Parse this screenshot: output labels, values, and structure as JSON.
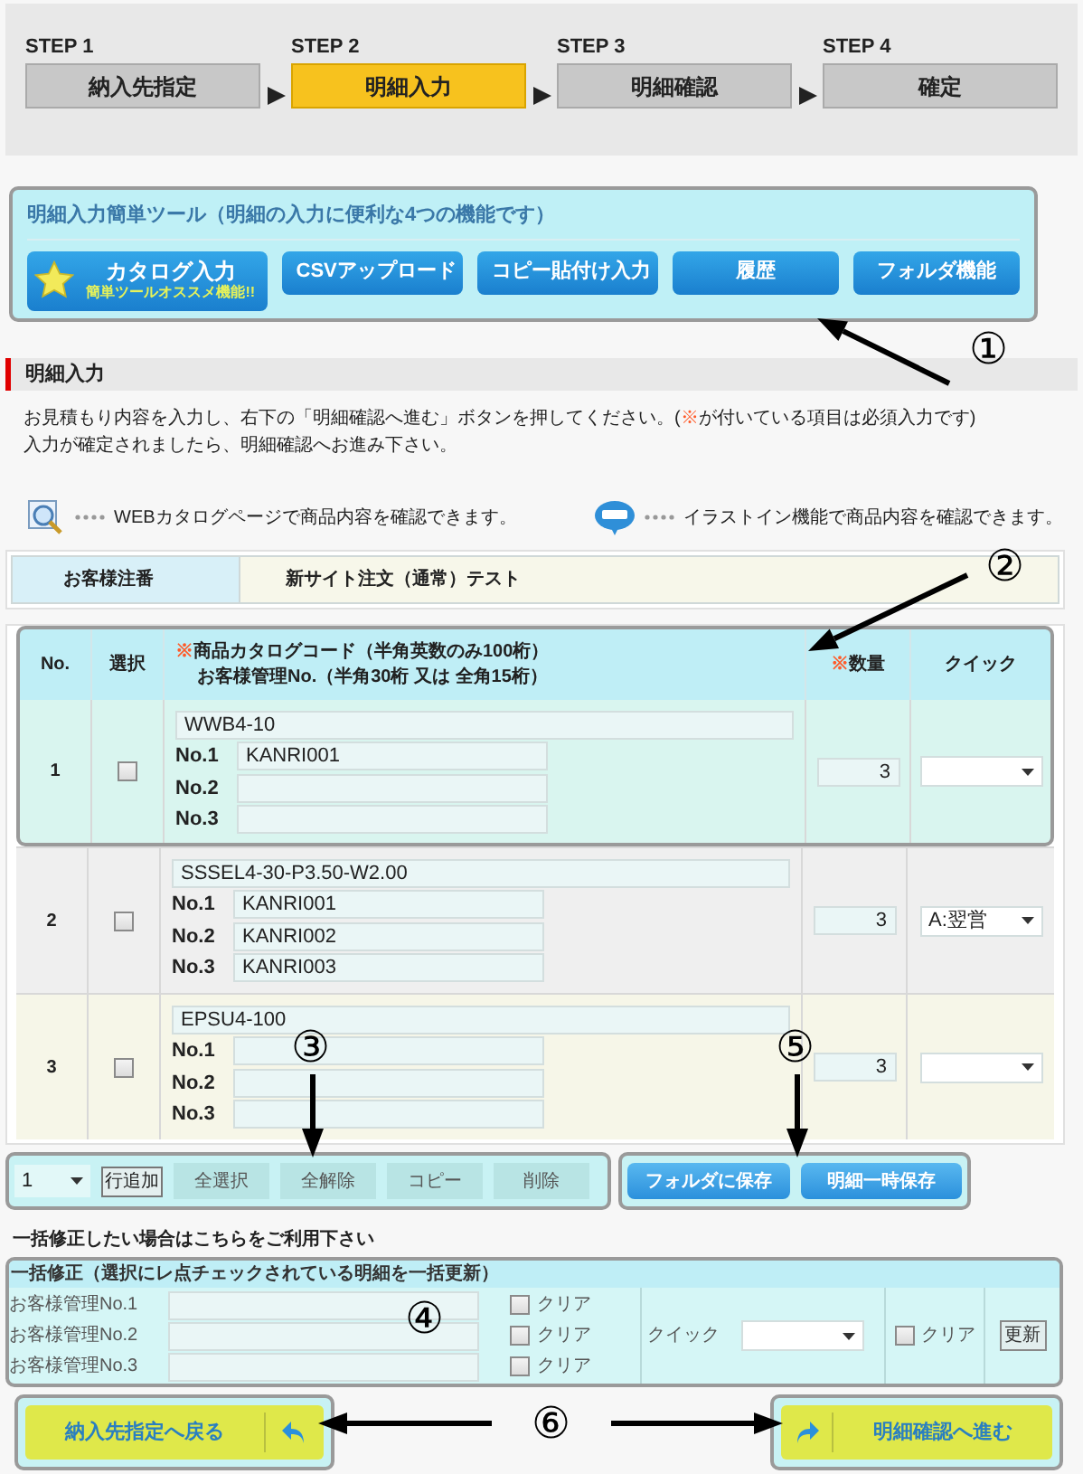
{
  "steps": [
    {
      "step": "STEP 1",
      "label": "納入先指定",
      "selected": false
    },
    {
      "step": "STEP 2",
      "label": "明細入力",
      "selected": true
    },
    {
      "step": "STEP 3",
      "label": "明細確認",
      "selected": false
    },
    {
      "step": "STEP 4",
      "label": "確定",
      "selected": false
    }
  ],
  "tools": {
    "title": "明細入力簡単ツール（明細の入力に便利な4つの機能です）",
    "buttons": [
      {
        "kind": "featured",
        "label": "カタログ入力",
        "sublabel": "簡単ツールオススメ機能!!"
      },
      {
        "kind": "plain",
        "label": "CSVアップロード"
      },
      {
        "kind": "plain",
        "label": "コピー貼付け入力"
      },
      {
        "kind": "plain",
        "label": "履歴"
      },
      {
        "kind": "plain",
        "label": "フォルダ機能"
      }
    ]
  },
  "section": {
    "title": "明細入力",
    "line1": {
      "before": "お見積もり内容を入力し、右下の「明細確認へ進む」ボタンを押してください。(",
      "mark": "※",
      "after": "が付いている項目は必須入力です)"
    },
    "line2": "入力が確定されましたら、明細確認へお進み下さい。"
  },
  "legend": [
    {
      "kind": "catalog",
      "text": "WEBカタログページで商品内容を確認できます。"
    },
    {
      "kind": "illust",
      "text": "イラストイン機能で商品内容を確認できます。"
    }
  ],
  "order": {
    "label": "お客様注番",
    "value": "新サイト注文（通常）テスト"
  },
  "table": {
    "columns": [
      {
        "lines": [
          "No."
        ]
      },
      {
        "lines": [
          "選択"
        ]
      },
      {
        "mark": "※",
        "lines": [
          "商品カタログコード（半角英数のみ100桁）",
          "お客様管理No.（半角30桁 又は 全角15桁）"
        ]
      },
      {
        "mark": "※",
        "lines": [
          "数量"
        ]
      },
      {
        "lines": [
          "クイック"
        ]
      }
    ],
    "rows": [
      {
        "no": "1",
        "checked": false,
        "color": "#d9f5ef",
        "code": "WWB4-10",
        "refs": [
          {
            "label": "No.1",
            "value": "KANRI001"
          },
          {
            "label": "No.2"
          },
          {
            "label": "No.3"
          }
        ],
        "qty": "3"
      },
      {
        "no": "2",
        "checked": false,
        "color": "#efefef",
        "code": "SSSEL4-30-P3.50-W2.00",
        "refs": [
          {
            "label": "No.1",
            "value": "KANRI001"
          },
          {
            "label": "No.2",
            "value": "KANRI002"
          },
          {
            "label": "No.3",
            "value": "KANRI003"
          }
        ],
        "qty": "3",
        "quick": "A:翌営"
      },
      {
        "no": "3",
        "checked": false,
        "color": "#f6f6e8",
        "code": "EPSU4-100",
        "refs": [
          {
            "label": "No.1"
          },
          {
            "label": "No.2"
          },
          {
            "label": "No.3"
          }
        ],
        "qty": "3"
      }
    ]
  },
  "toolbar": {
    "count": "1",
    "add": "行追加",
    "buttons": [
      "全選択",
      "全解除",
      "コピー",
      "削除"
    ],
    "save_buttons": [
      "フォルダに保存",
      "明細一時保存"
    ]
  },
  "bulk": {
    "intro": "一括修正したい場合はこちらをご利用下さい",
    "title": "一括修正（選択にレ点チェックされている明細を一括更新）",
    "fields": [
      {
        "label": "お客様管理No.1",
        "clear": "クリア",
        "checked": false
      },
      {
        "label": "お客様管理No.2",
        "clear": "クリア",
        "checked": false
      },
      {
        "label": "お客様管理No.3",
        "clear": "クリア",
        "checked": false
      }
    ],
    "quick_label": "クイック",
    "quick_clear": {
      "label": "クリア",
      "checked": false
    },
    "update": "更新"
  },
  "nav": {
    "back": "納入先指定へ戻る",
    "next": "明細確認へ進む"
  },
  "callouts": [
    {
      "label": "①"
    },
    {
      "label": "②"
    },
    {
      "label": "③"
    },
    {
      "label": "④"
    },
    {
      "label": "⑤"
    },
    {
      "label": "⑥"
    }
  ]
}
